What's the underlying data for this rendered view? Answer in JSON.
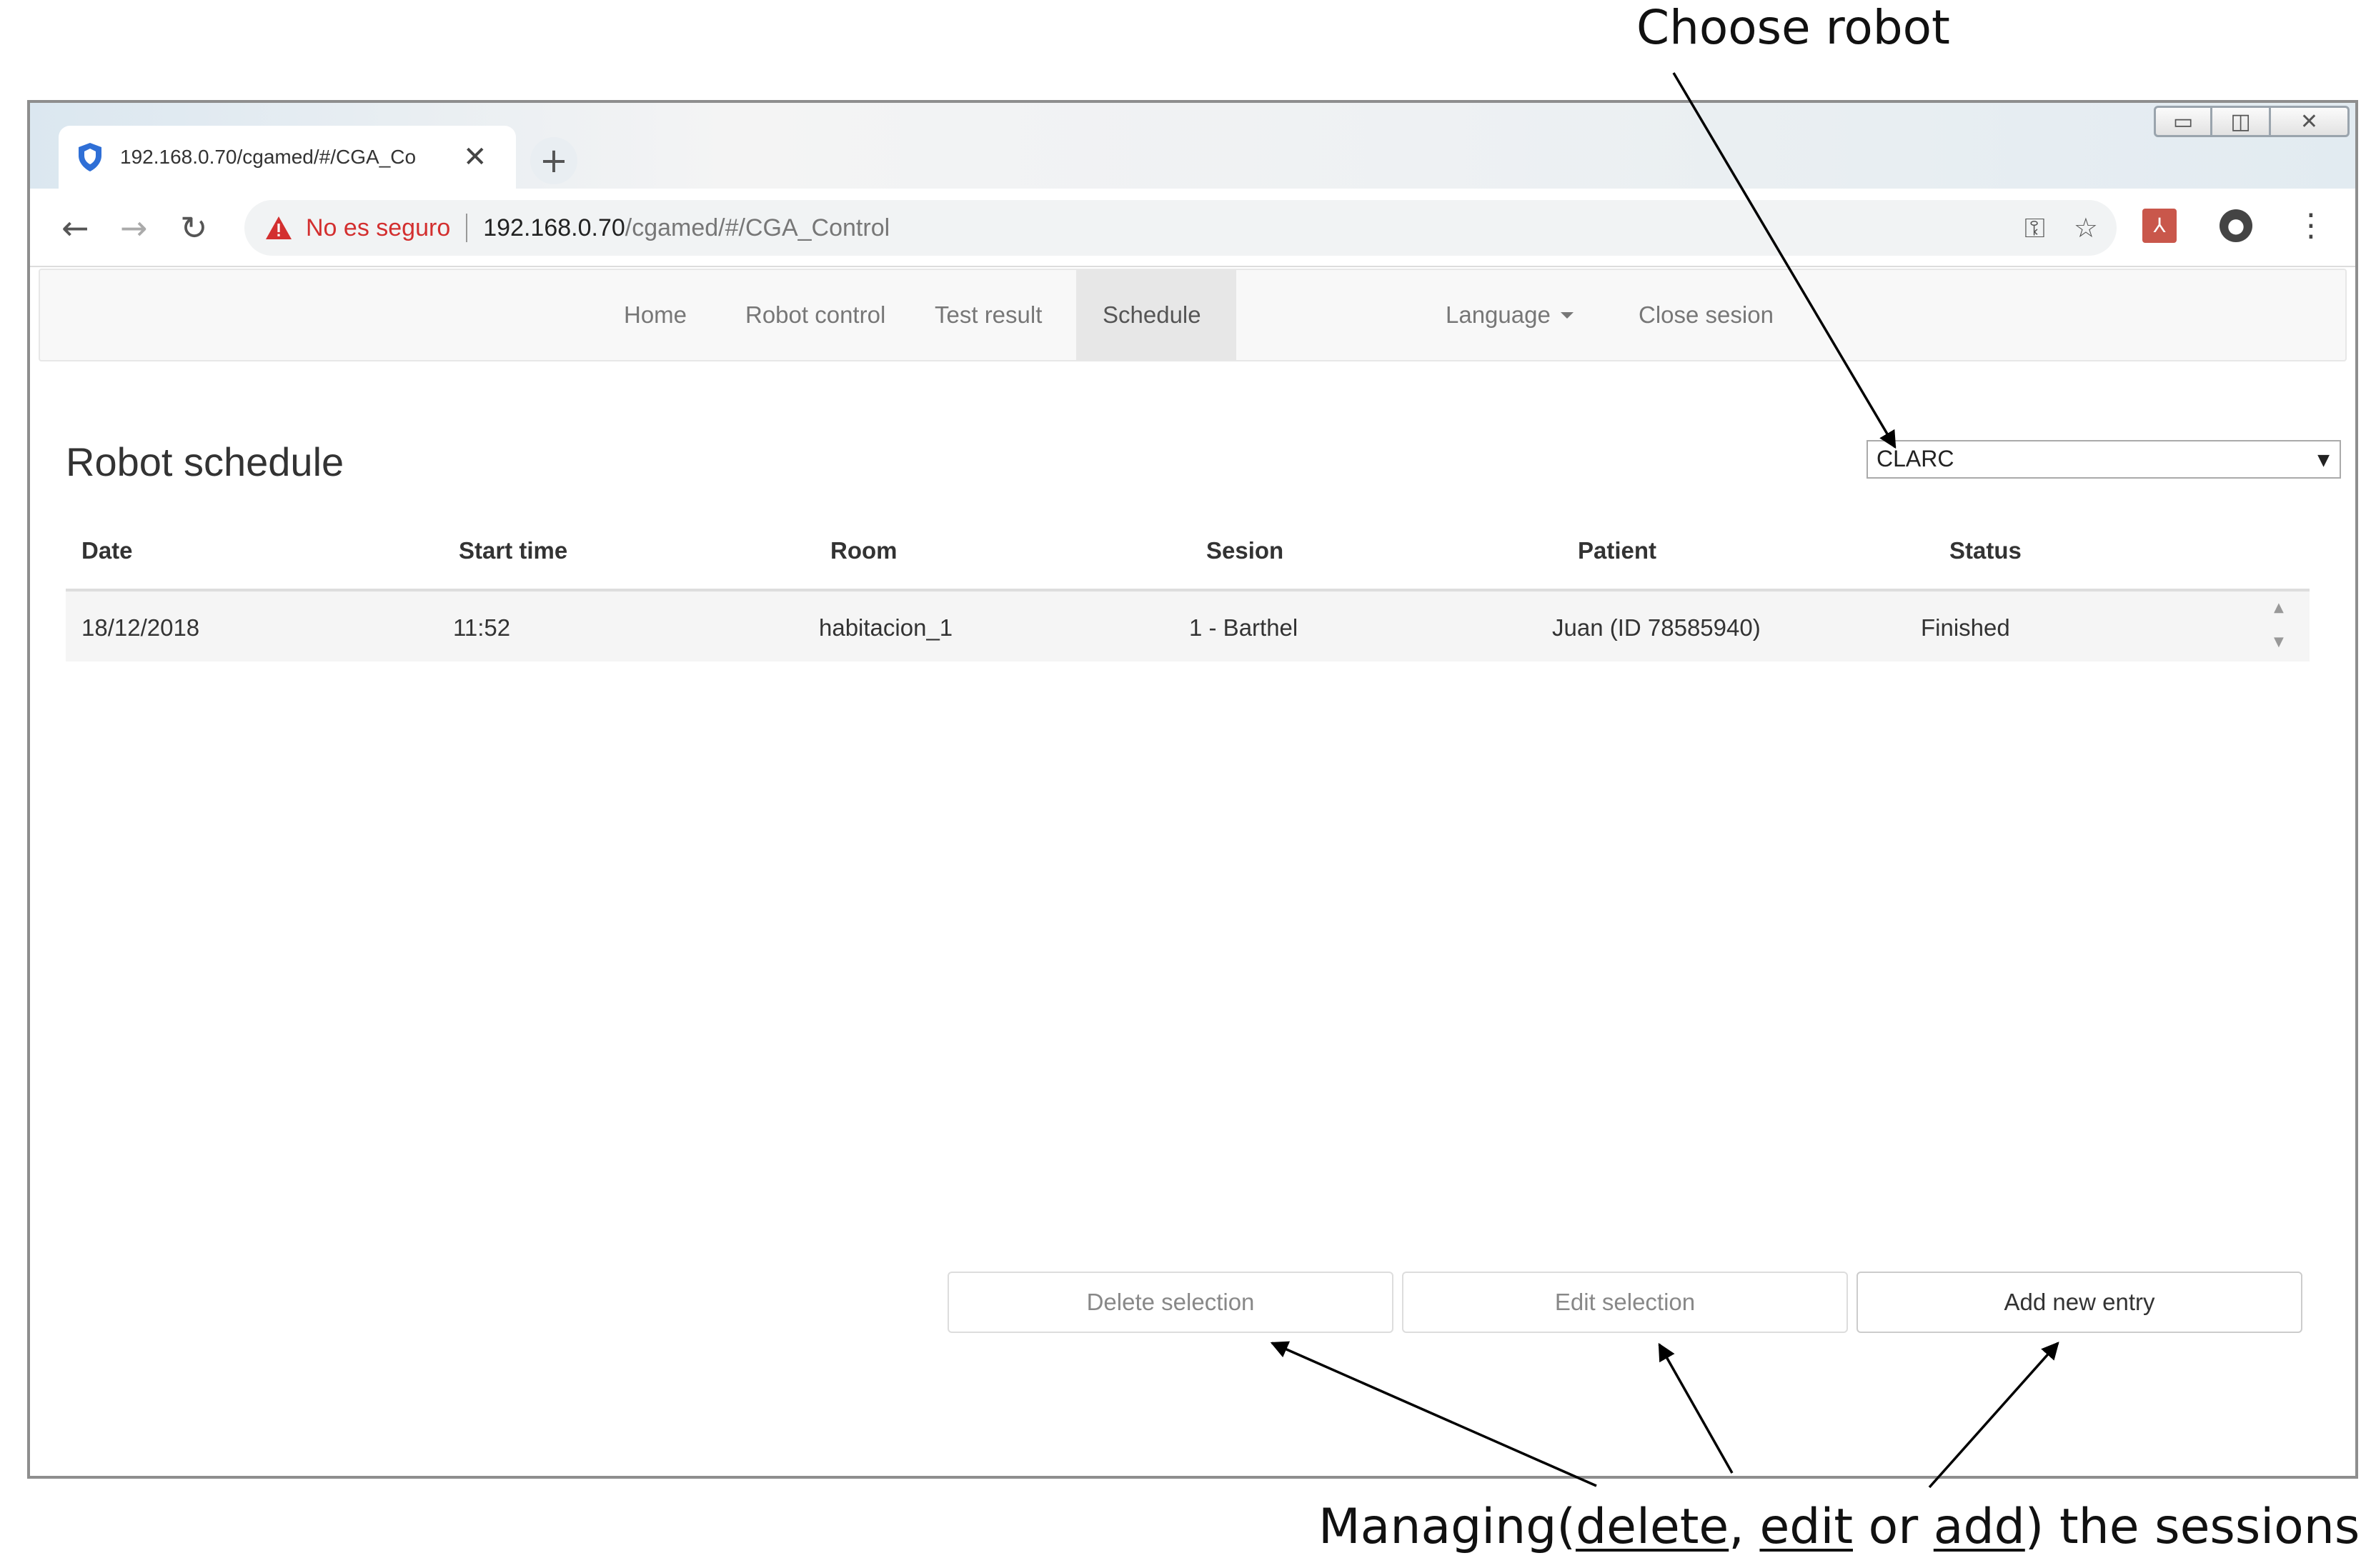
{
  "annotations": {
    "top": "Choose robot",
    "bottom_prefix": "Managing(",
    "bottom_delete": "delete",
    "bottom_comma": ", ",
    "bottom_edit": "edit",
    "bottom_or": " or ",
    "bottom_add": "add",
    "bottom_suffix": ") the sessions"
  },
  "browser": {
    "tab_title": "192.168.0.70/cgamed/#/CGA_Co",
    "tab_close": "✕",
    "new_tab": "+",
    "back": "←",
    "forward": "→",
    "reload": "↻",
    "security_label": "No es seguro",
    "url_host": "192.168.0.70",
    "url_path": "/cgamed/#/CGA_Control",
    "icons": [
      "key-icon",
      "star-icon",
      "pdf-icon",
      "account-icon",
      "menu-icon"
    ]
  },
  "nav": {
    "items": [
      "Home",
      "Robot control",
      "Test result",
      "Schedule"
    ],
    "active": "Schedule",
    "language": "Language",
    "close_session": "Close sesion"
  },
  "page": {
    "title": "Robot schedule",
    "robot_selected": "CLARC"
  },
  "table": {
    "columns": [
      "Date",
      "Start time",
      "Room",
      "Sesion",
      "Patient",
      "Status"
    ],
    "rows": [
      [
        "18/12/2018",
        "11:52",
        "habitacion_1",
        "1 - Barthel",
        "Juan (ID 78585940)",
        "Finished"
      ]
    ]
  },
  "actions": {
    "delete": "Delete selection",
    "edit": "Edit selection",
    "add": "Add new entry"
  }
}
